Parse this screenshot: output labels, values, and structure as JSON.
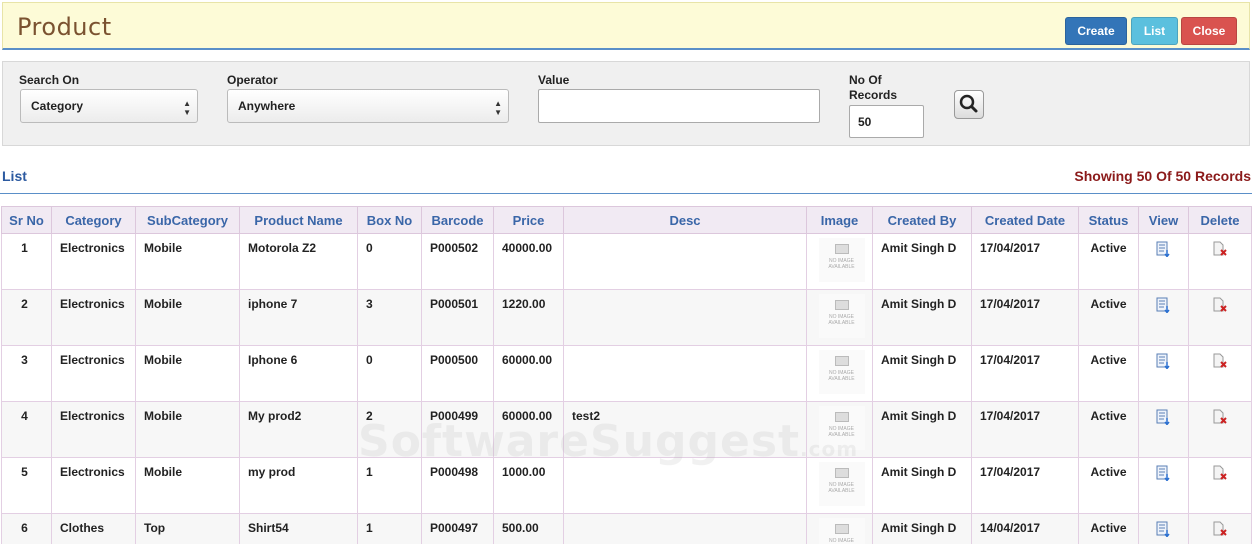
{
  "header": {
    "title": "Product",
    "buttons": {
      "create": "Create",
      "list": "List",
      "close": "Close"
    }
  },
  "search": {
    "search_on_label": "Search On",
    "search_on_value": "Category",
    "operator_label": "Operator",
    "operator_value": "Anywhere",
    "value_label": "Value",
    "value_value": "",
    "records_label_1": "No Of",
    "records_label_2": "Records",
    "records_value": "50",
    "search_icon": "magnifier-icon"
  },
  "list": {
    "title": "List",
    "showing": "Showing 50 Of 50 Records"
  },
  "table": {
    "columns": [
      "Sr No",
      "Category",
      "SubCategory",
      "Product Name",
      "Box No",
      "Barcode",
      "Price",
      "Desc",
      "Image",
      "Created By",
      "Created Date",
      "Status",
      "View",
      "Delete"
    ],
    "no_image_text_1": "NO IMAGE",
    "no_image_text_2": "AVAILABLE",
    "rows": [
      {
        "sr": "1",
        "category": "Electronics",
        "subcategory": "Mobile",
        "name": "Motorola Z2",
        "box": "0",
        "barcode": "P000502",
        "price": "40000.00",
        "desc": "",
        "created_by": "Amit Singh D",
        "created_date": "17/04/2017",
        "status": "Active"
      },
      {
        "sr": "2",
        "category": "Electronics",
        "subcategory": "Mobile",
        "name": "iphone 7",
        "box": "3",
        "barcode": "P000501",
        "price": "1220.00",
        "desc": "",
        "created_by": "Amit Singh D",
        "created_date": "17/04/2017",
        "status": "Active"
      },
      {
        "sr": "3",
        "category": "Electronics",
        "subcategory": "Mobile",
        "name": "Iphone 6",
        "box": "0",
        "barcode": "P000500",
        "price": "60000.00",
        "desc": "",
        "created_by": "Amit Singh D",
        "created_date": "17/04/2017",
        "status": "Active"
      },
      {
        "sr": "4",
        "category": "Electronics",
        "subcategory": "Mobile",
        "name": "My prod2",
        "box": "2",
        "barcode": "P000499",
        "price": "60000.00",
        "desc": "test2",
        "created_by": "Amit Singh D",
        "created_date": "17/04/2017",
        "status": "Active"
      },
      {
        "sr": "5",
        "category": "Electronics",
        "subcategory": "Mobile",
        "name": "my prod",
        "box": "1",
        "barcode": "P000498",
        "price": "1000.00",
        "desc": "",
        "created_by": "Amit Singh D",
        "created_date": "17/04/2017",
        "status": "Active"
      },
      {
        "sr": "6",
        "category": "Clothes",
        "subcategory": "Top",
        "name": "Shirt54",
        "box": "1",
        "barcode": "P000497",
        "price": "500.00",
        "desc": "",
        "created_by": "Amit Singh D",
        "created_date": "14/04/2017",
        "status": "Active"
      }
    ]
  },
  "watermark": {
    "main": "SoftwareSuggest",
    "suffix": ".com"
  },
  "colors": {
    "create": "#3375b8",
    "list": "#5bc0de",
    "close": "#d9534f",
    "header_bg": "#fdfbd7",
    "title": "#7a5230",
    "showing": "#8b1a1a"
  }
}
